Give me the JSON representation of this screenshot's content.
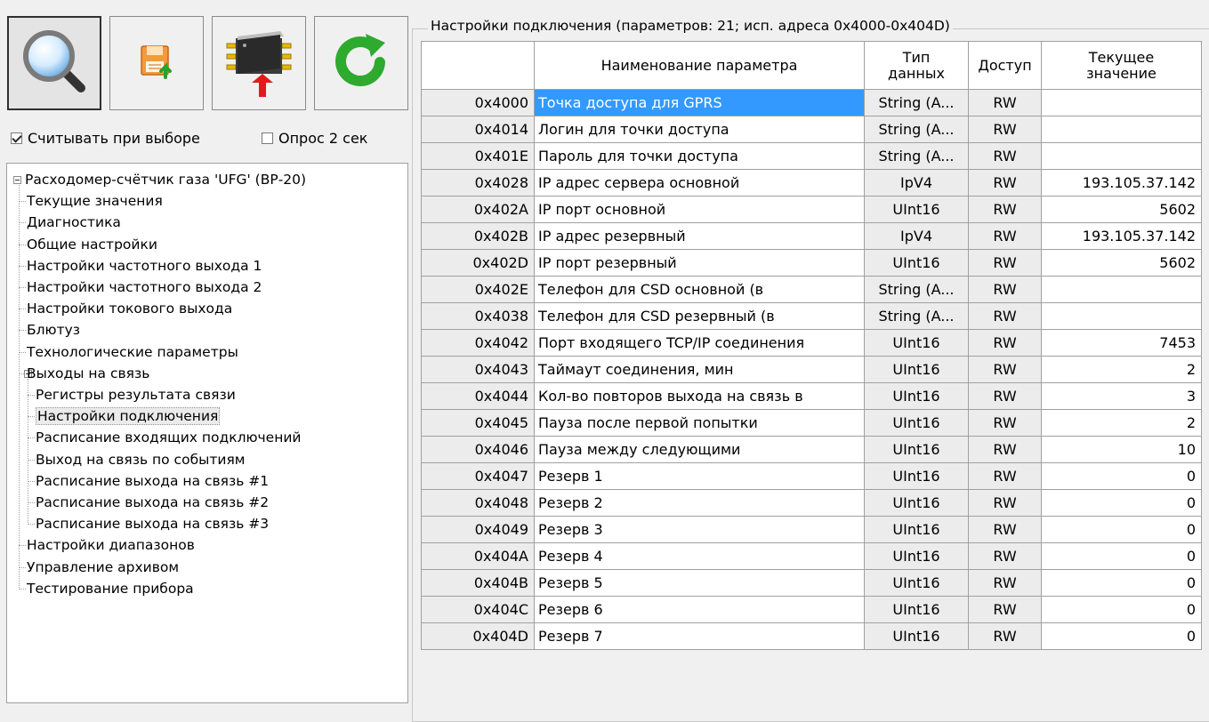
{
  "toolbar": {
    "buttons": [
      {
        "name": "search-button",
        "icon": "magnifier-icon"
      },
      {
        "name": "save-button",
        "icon": "floppy-upload-icon"
      },
      {
        "name": "write-device-button",
        "icon": "chip-write-icon"
      },
      {
        "name": "refresh-button",
        "icon": "refresh-icon"
      }
    ]
  },
  "options": {
    "read_on_select": {
      "label": "Считывать при выборе",
      "checked": true
    },
    "poll_2s": {
      "label": "Опрос 2 сек",
      "checked": false
    }
  },
  "tree": {
    "root": "Расходомер-счётчик газа 'UFG' (ВР-20)",
    "items": [
      "Текущие значения",
      "Диагностика",
      "Общие настройки",
      "Настройки частотного выхода 1",
      "Настройки частотного выхода 2",
      "Настройки токового выхода",
      "Блютуз",
      "Технологические параметры",
      "Выходы на связь"
    ],
    "sub_items": [
      "Регистры результата связи",
      "Настройки подключения",
      "Расписание входящих подключений",
      "Выход на связь по событиям",
      "Расписание выхода на связь #1",
      "Расписание выхода на связь #2",
      "Расписание выхода на связь #3"
    ],
    "after_items": [
      "Настройки диапазонов",
      "Управление архивом",
      "Тестирование прибора"
    ],
    "selected": "Настройки подключения"
  },
  "grid": {
    "title": "Настройки подключения (параметров: 21; исп. адреса 0x4000-0x404D)",
    "headers": {
      "name": "Наименование параметра",
      "type": "Тип данных",
      "access": "Доступ",
      "value": "Текущее значение"
    },
    "rows": [
      {
        "addr": "0x4000",
        "name": "Точка доступа для GPRS",
        "type": "String (A...",
        "access": "RW",
        "value": ""
      },
      {
        "addr": "0x4014",
        "name": "Логин для точки доступа",
        "type": "String (A...",
        "access": "RW",
        "value": ""
      },
      {
        "addr": "0x401E",
        "name": "Пароль для точки доступа",
        "type": "String (A...",
        "access": "RW",
        "value": ""
      },
      {
        "addr": "0x4028",
        "name": "IP адрес сервера основной",
        "type": "IpV4",
        "access": "RW",
        "value": "193.105.37.142"
      },
      {
        "addr": "0x402A",
        "name": "IP порт основной",
        "type": "UInt16",
        "access": "RW",
        "value": "5602"
      },
      {
        "addr": "0x402B",
        "name": "IP адрес резервный",
        "type": "IpV4",
        "access": "RW",
        "value": "193.105.37.142"
      },
      {
        "addr": "0x402D",
        "name": "IP порт резервный",
        "type": "UInt16",
        "access": "RW",
        "value": "5602"
      },
      {
        "addr": "0x402E",
        "name": "Телефон для CSD основной (в",
        "type": "String (A...",
        "access": "RW",
        "value": ""
      },
      {
        "addr": "0x4038",
        "name": "Телефон для CSD резервный (в",
        "type": "String (A...",
        "access": "RW",
        "value": ""
      },
      {
        "addr": "0x4042",
        "name": "Порт входящего TCP/IP соединения",
        "type": "UInt16",
        "access": "RW",
        "value": "7453"
      },
      {
        "addr": "0x4043",
        "name": "Таймаут соединения, мин",
        "type": "UInt16",
        "access": "RW",
        "value": "2"
      },
      {
        "addr": "0x4044",
        "name": "Кол-во повторов выхода на связь в",
        "type": "UInt16",
        "access": "RW",
        "value": "3"
      },
      {
        "addr": "0x4045",
        "name": "Пауза после первой попытки",
        "type": "UInt16",
        "access": "RW",
        "value": "2"
      },
      {
        "addr": "0x4046",
        "name": "Пауза между следующими",
        "type": "UInt16",
        "access": "RW",
        "value": "10"
      },
      {
        "addr": "0x4047",
        "name": "Резерв 1",
        "type": "UInt16",
        "access": "RW",
        "value": "0"
      },
      {
        "addr": "0x4048",
        "name": "Резерв 2",
        "type": "UInt16",
        "access": "RW",
        "value": "0"
      },
      {
        "addr": "0x4049",
        "name": "Резерв 3",
        "type": "UInt16",
        "access": "RW",
        "value": "0"
      },
      {
        "addr": "0x404A",
        "name": "Резерв 4",
        "type": "UInt16",
        "access": "RW",
        "value": "0"
      },
      {
        "addr": "0x404B",
        "name": "Резерв 5",
        "type": "UInt16",
        "access": "RW",
        "value": "0"
      },
      {
        "addr": "0x404C",
        "name": "Резерв 6",
        "type": "UInt16",
        "access": "RW",
        "value": "0"
      },
      {
        "addr": "0x404D",
        "name": "Резерв 7",
        "type": "UInt16",
        "access": "RW",
        "value": "0"
      }
    ],
    "selected_row": 0,
    "colors": {
      "selection": "#3399ff",
      "readonly_cell": "#ececec"
    }
  }
}
